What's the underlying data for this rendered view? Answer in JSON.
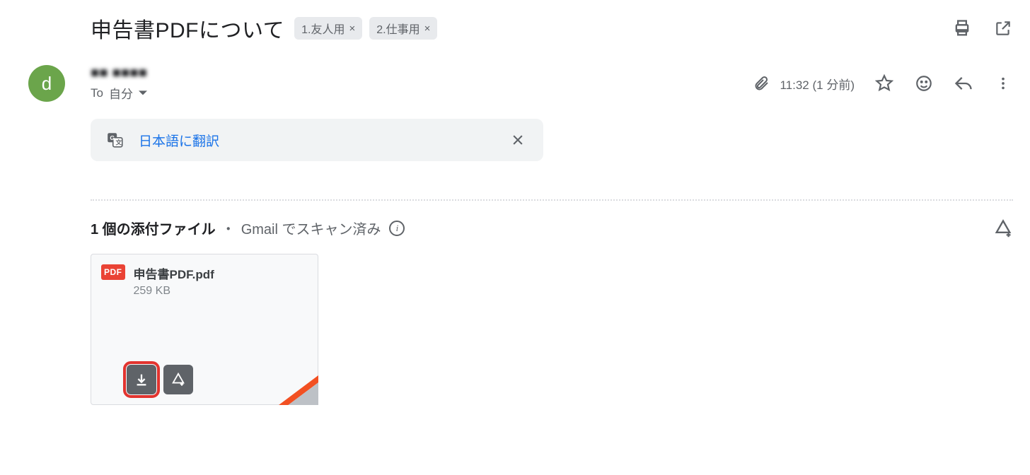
{
  "subject": {
    "title": "申告書PDFについて",
    "labels": [
      {
        "text": "1.友人用"
      },
      {
        "text": "2.仕事用"
      }
    ]
  },
  "sender": {
    "avatar_letter": "d",
    "name": "■■ ■■■■",
    "recipient_prefix": "To",
    "recipient": "自分"
  },
  "meta": {
    "time": "11:32 (1 分前)"
  },
  "translate": {
    "link_text": "日本語に翻訳"
  },
  "attachments": {
    "count_label": "1 個の添付ファイル",
    "bullet": "・",
    "scanned_label": "Gmail でスキャン済み",
    "items": [
      {
        "badge": "PDF",
        "name": "申告書PDF.pdf",
        "size": "259 KB"
      }
    ]
  }
}
